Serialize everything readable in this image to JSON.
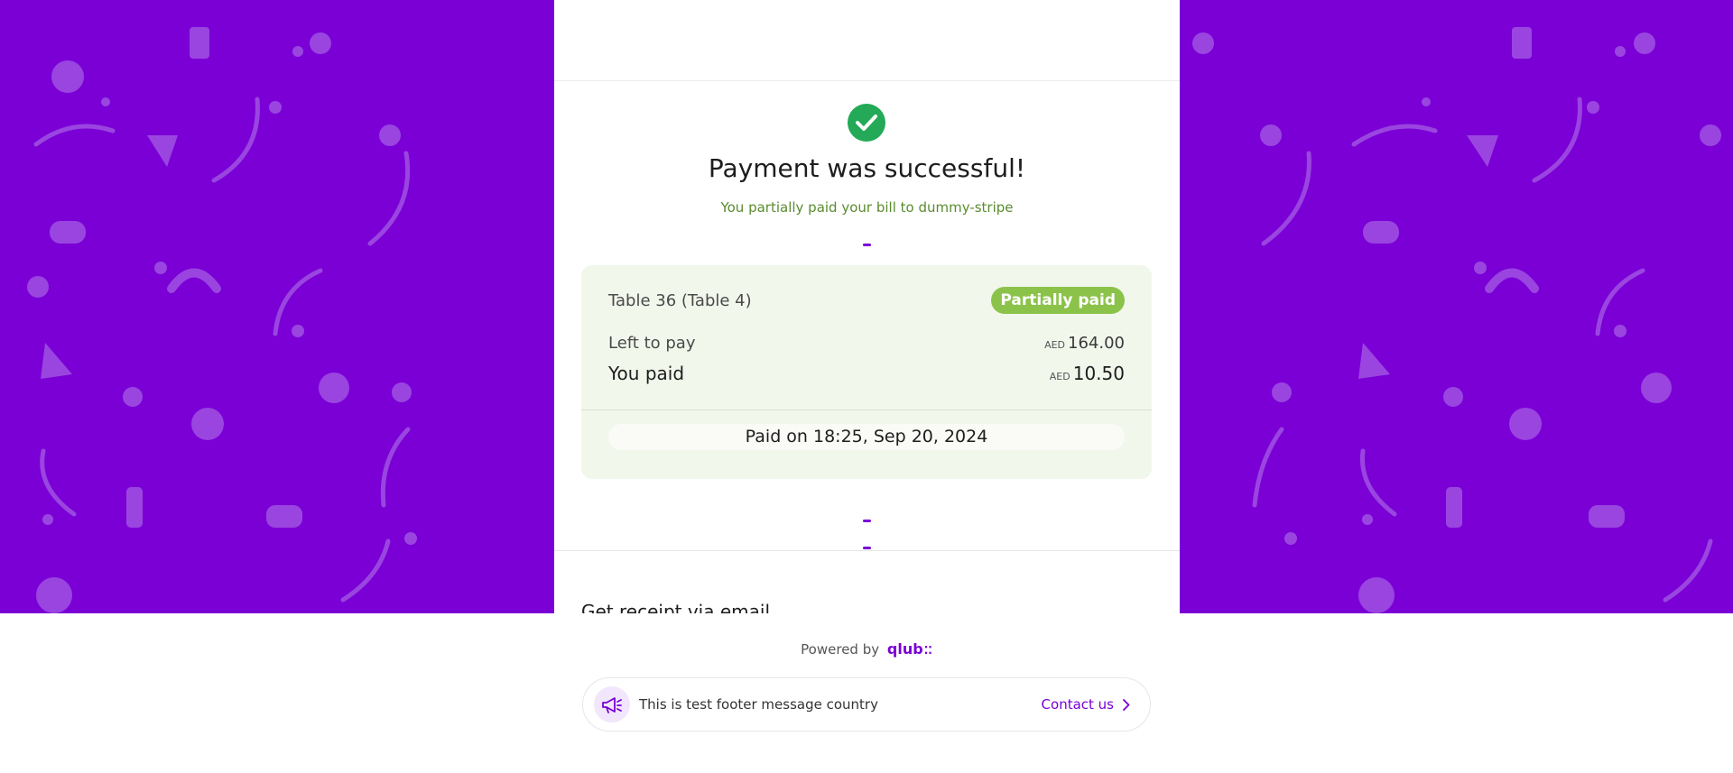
{
  "colors": {
    "brand": "#7a00d6",
    "success": "#23a957",
    "badge": "#8bc34a",
    "subtitle": "#5a8c2f"
  },
  "status": {
    "icon": "check-circle-icon",
    "title": "Payment was successful!",
    "subtitle": "You partially paid your bill to dummy-stripe"
  },
  "bill": {
    "table": "Table 36 (Table 4)",
    "badge": "Partially paid",
    "left_label": "Left to pay",
    "left_currency": "AED",
    "left_amount": "164.00",
    "paid_label": "You paid",
    "paid_currency": "AED",
    "paid_amount": "10.50",
    "paid_on": "Paid on 18:25, Sep 20, 2024"
  },
  "receipt": {
    "title": "Get receipt via email"
  },
  "powered": {
    "label": "Powered by",
    "brand": "qlub"
  },
  "footer": {
    "icon": "megaphone-icon",
    "message": "This is test footer message country",
    "contact_label": "Contact us",
    "contact_icon": "chevron-right-icon"
  }
}
